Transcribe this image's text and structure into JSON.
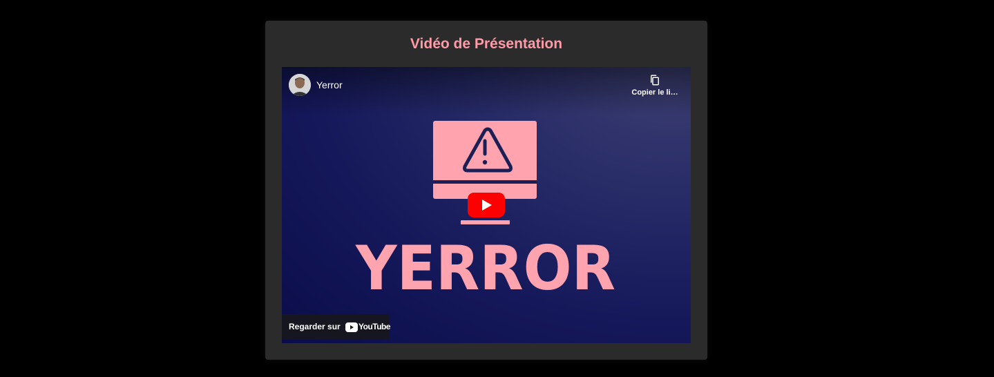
{
  "card": {
    "title": "Vidéo de Présentation"
  },
  "video": {
    "channel_name": "Yerror",
    "copy_link_label": "Copier le li…",
    "thumbnail_text": "YERROR",
    "watch_on_label": "Regarder sur",
    "youtube_logo_text": "YouTube"
  },
  "colors": {
    "page_background": "#000000",
    "card_background": "#2b2b2b",
    "title_color": "#ff9aa6",
    "thumbnail_pink": "#ffa3ae",
    "thumbnail_navy": "#1c1f55",
    "play_red": "#ff0000"
  },
  "icons": {
    "copy": "copy-icon",
    "warning": "warning-icon",
    "monitor": "monitor-icon",
    "play": "play-icon",
    "youtube": "youtube-logo-icon"
  }
}
